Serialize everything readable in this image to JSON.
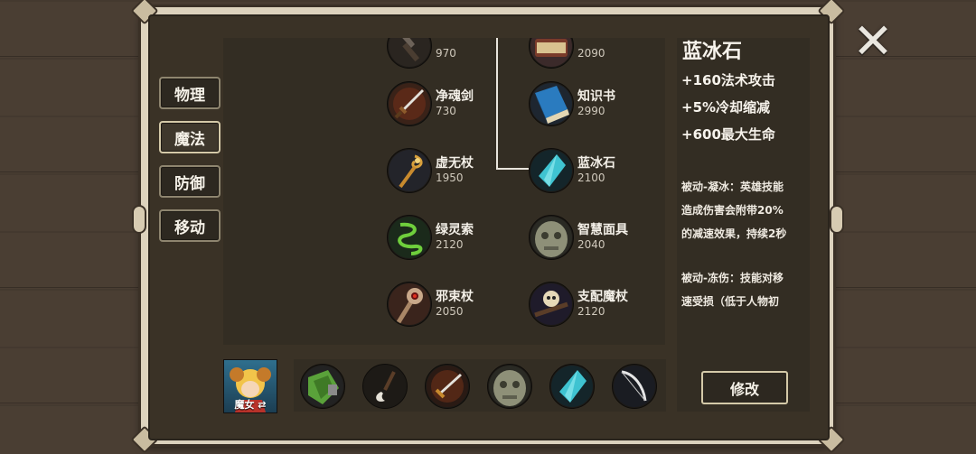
{
  "close_icon": "✕",
  "tabs": [
    {
      "label": "物理",
      "active": false
    },
    {
      "label": "魔法",
      "active": true
    },
    {
      "label": "防御",
      "active": false
    },
    {
      "label": "移动",
      "active": false
    }
  ],
  "items": [
    {
      "name": "",
      "price": "970",
      "icon": "dark-weapon-icon"
    },
    {
      "name": "",
      "price": "2090",
      "icon": "tome-icon"
    },
    {
      "name": "净魂剑",
      "price": "730",
      "icon": "sword-icon"
    },
    {
      "name": "知识书",
      "price": "2990",
      "icon": "blue-book-icon"
    },
    {
      "name": "虚无杖",
      "price": "1950",
      "icon": "golden-staff-icon"
    },
    {
      "name": "蓝冰石",
      "price": "2100",
      "icon": "ice-crystal-icon"
    },
    {
      "name": "绿灵索",
      "price": "2120",
      "icon": "green-rope-icon"
    },
    {
      "name": "智慧面具",
      "price": "2040",
      "icon": "stone-mask-icon"
    },
    {
      "name": "邪束杖",
      "price": "2050",
      "icon": "skull-staff-icon"
    },
    {
      "name": "支配魔杖",
      "price": "2120",
      "icon": "skull-wand-icon"
    }
  ],
  "detail": {
    "title": "蓝冰石",
    "stats": [
      "+160法术攻击",
      "+5%冷却缩减",
      "+600最大生命"
    ],
    "passive1": [
      "被动-凝冰：英雄技能",
      "造成伤害会附带20%",
      "的减速效果，持续2秒"
    ],
    "passive2": [
      "被动-冻伤：技能对移",
      "速受损（低于人物初"
    ],
    "modify_label": "修改"
  },
  "hero": {
    "label": "魔女 ⇄"
  },
  "loadout": [
    {
      "icon": "green-armor-icon"
    },
    {
      "icon": "dagger-icon"
    },
    {
      "icon": "sword-icon"
    },
    {
      "icon": "stone-mask-icon"
    },
    {
      "icon": "ice-crystal-icon"
    },
    {
      "icon": "bow-icon"
    }
  ]
}
